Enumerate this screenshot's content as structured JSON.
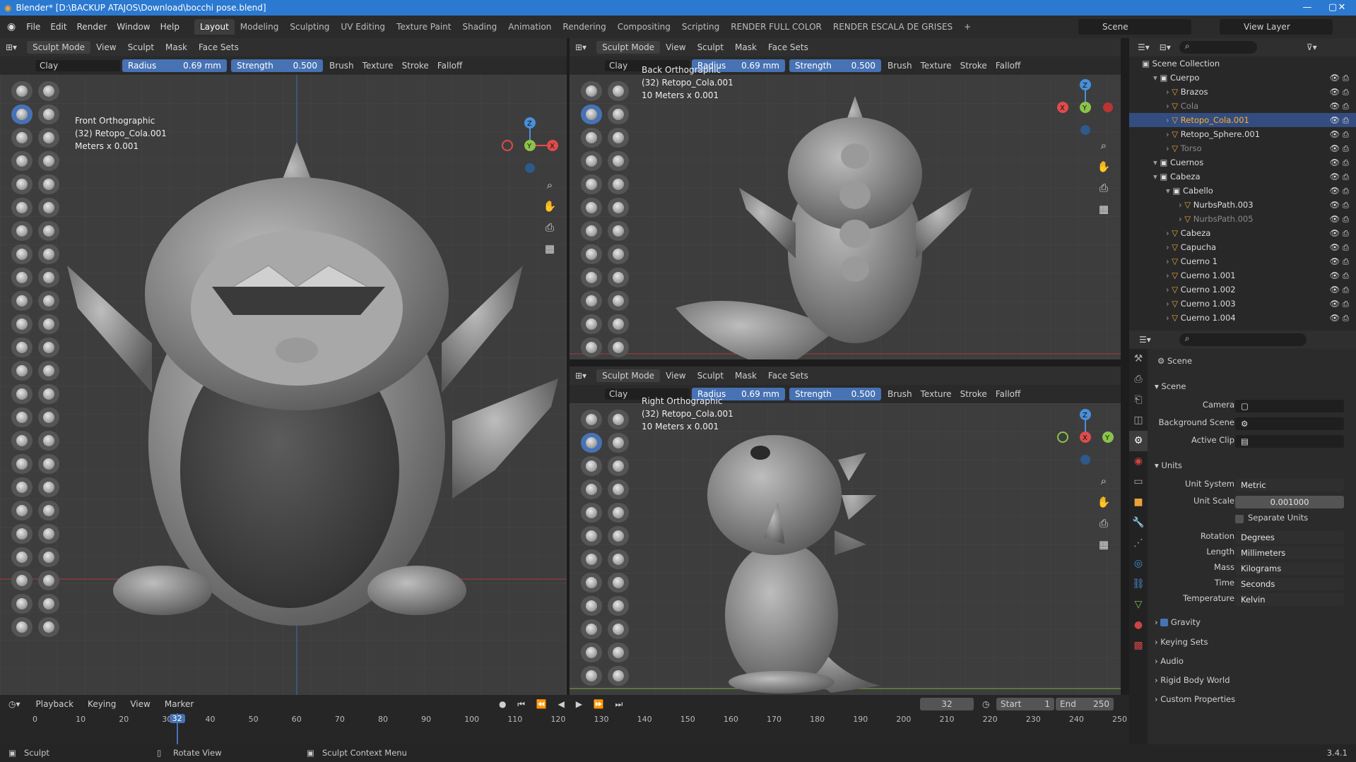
{
  "window": {
    "title": "Blender* [D:\\BACKUP ATAJOS\\Download\\bocchi pose.blend]",
    "minimize": "—",
    "maximize": "▢",
    "close": "✕"
  },
  "menu": {
    "items": [
      "File",
      "Edit",
      "Render",
      "Window",
      "Help"
    ]
  },
  "workspaces": [
    "Layout",
    "Modeling",
    "Sculpting",
    "UV Editing",
    "Texture Paint",
    "Shading",
    "Animation",
    "Rendering",
    "Compositing",
    "Scripting",
    "RENDER FULL COLOR",
    "RENDER ESCALA DE GRISES",
    "+"
  ],
  "scene": {
    "label": "Scene",
    "view_layer": "View Layer"
  },
  "header": {
    "mode": "Sculpt Mode",
    "view": "View",
    "sculpt": "Sculpt",
    "mask": "Mask",
    "face_sets": "Face Sets"
  },
  "toolsettings": {
    "brush": "Clay",
    "radius_label": "Radius",
    "radius_value": "0.69 mm",
    "strength_label": "Strength",
    "strength_value": "0.500",
    "brush_menu": "Brush",
    "texture_menu": "Texture",
    "stroke_menu": "Stroke",
    "falloff_menu": "Falloff"
  },
  "viewports": {
    "front": {
      "view": "Front Orthographic",
      "object": "(32) Retopo_Cola.001",
      "scale": "Meters x 0.001"
    },
    "back": {
      "view": "Back Orthographic",
      "object": "(32) Retopo_Cola.001",
      "scale": "10 Meters x 0.001"
    },
    "right": {
      "view": "Right Orthographic",
      "object": "(32) Retopo_Cola.001",
      "scale": "10 Meters x 0.001"
    }
  },
  "gizmo": {
    "x": "X",
    "y": "Y",
    "z": "Z",
    "color_x": "#e04b4b",
    "color_y": "#8bc34a",
    "color_z": "#4a90d9"
  },
  "outliner": {
    "root": "Scene Collection",
    "rows": [
      {
        "indent": 1,
        "label": "Cuerpo",
        "type": "collection",
        "sel": false,
        "dim": false
      },
      {
        "indent": 2,
        "label": "Brazos",
        "type": "object",
        "sel": false,
        "dim": false
      },
      {
        "indent": 2,
        "label": "Cola",
        "type": "object",
        "sel": false,
        "dim": true
      },
      {
        "indent": 2,
        "label": "Retopo_Cola.001",
        "type": "object",
        "sel": true,
        "dim": false
      },
      {
        "indent": 2,
        "label": "Retopo_Sphere.001",
        "type": "object",
        "sel": false,
        "dim": false
      },
      {
        "indent": 2,
        "label": "Torso",
        "type": "object",
        "sel": false,
        "dim": true
      },
      {
        "indent": 1,
        "label": "Cuernos",
        "type": "collection",
        "sel": false,
        "dim": false
      },
      {
        "indent": 1,
        "label": "Cabeza",
        "type": "collection",
        "sel": false,
        "dim": false
      },
      {
        "indent": 2,
        "label": "Cabello",
        "type": "collection",
        "sel": false,
        "dim": false
      },
      {
        "indent": 3,
        "label": "NurbsPath.003",
        "type": "object",
        "sel": false,
        "dim": false
      },
      {
        "indent": 3,
        "label": "NurbsPath.005",
        "type": "object",
        "sel": false,
        "dim": true
      },
      {
        "indent": 2,
        "label": "Cabeza",
        "type": "object",
        "sel": false,
        "dim": false
      },
      {
        "indent": 2,
        "label": "Capucha",
        "type": "object",
        "sel": false,
        "dim": false
      },
      {
        "indent": 2,
        "label": "Cuerno 1",
        "type": "object",
        "sel": false,
        "dim": false
      },
      {
        "indent": 2,
        "label": "Cuerno 1.001",
        "type": "object",
        "sel": false,
        "dim": false
      },
      {
        "indent": 2,
        "label": "Cuerno 1.002",
        "type": "object",
        "sel": false,
        "dim": false
      },
      {
        "indent": 2,
        "label": "Cuerno 1.003",
        "type": "object",
        "sel": false,
        "dim": false
      },
      {
        "indent": 2,
        "label": "Cuerno 1.004",
        "type": "object",
        "sel": false,
        "dim": false
      }
    ]
  },
  "properties": {
    "context": "Scene",
    "scene_panel": "Scene",
    "camera": "Camera",
    "background_scene": "Background Scene",
    "active_clip": "Active Clip",
    "units_panel": "Units",
    "unit_system_label": "Unit System",
    "unit_system": "Metric",
    "unit_scale_label": "Unit Scale",
    "unit_scale": "0.001000",
    "separate_units": "Separate Units",
    "rotation_label": "Rotation",
    "rotation": "Degrees",
    "length_label": "Length",
    "length": "Millimeters",
    "mass_label": "Mass",
    "mass": "Kilograms",
    "time_label": "Time",
    "time": "Seconds",
    "temperature_label": "Temperature",
    "temperature": "Kelvin",
    "gravity": "Gravity",
    "keying_sets": "Keying Sets",
    "audio": "Audio",
    "rigid_body_world": "Rigid Body World",
    "custom_properties": "Custom Properties"
  },
  "timeline": {
    "playback": "Playback",
    "keying": "Keying",
    "view": "View",
    "marker": "Marker",
    "current_frame": "32",
    "start_label": "Start",
    "start": "1",
    "end_label": "End",
    "end": "250",
    "ticks": [
      "0",
      "10",
      "20",
      "30",
      "40",
      "50",
      "60",
      "70",
      "80",
      "90",
      "100",
      "110",
      "120",
      "130",
      "140",
      "150",
      "160",
      "170",
      "180",
      "190",
      "200",
      "210",
      "220",
      "230",
      "240",
      "250"
    ],
    "current": 32,
    "range_end": 250
  },
  "status": {
    "left": "Sculpt",
    "middle": "Rotate View",
    "right": "Sculpt Context Menu",
    "version": "3.4.1"
  }
}
